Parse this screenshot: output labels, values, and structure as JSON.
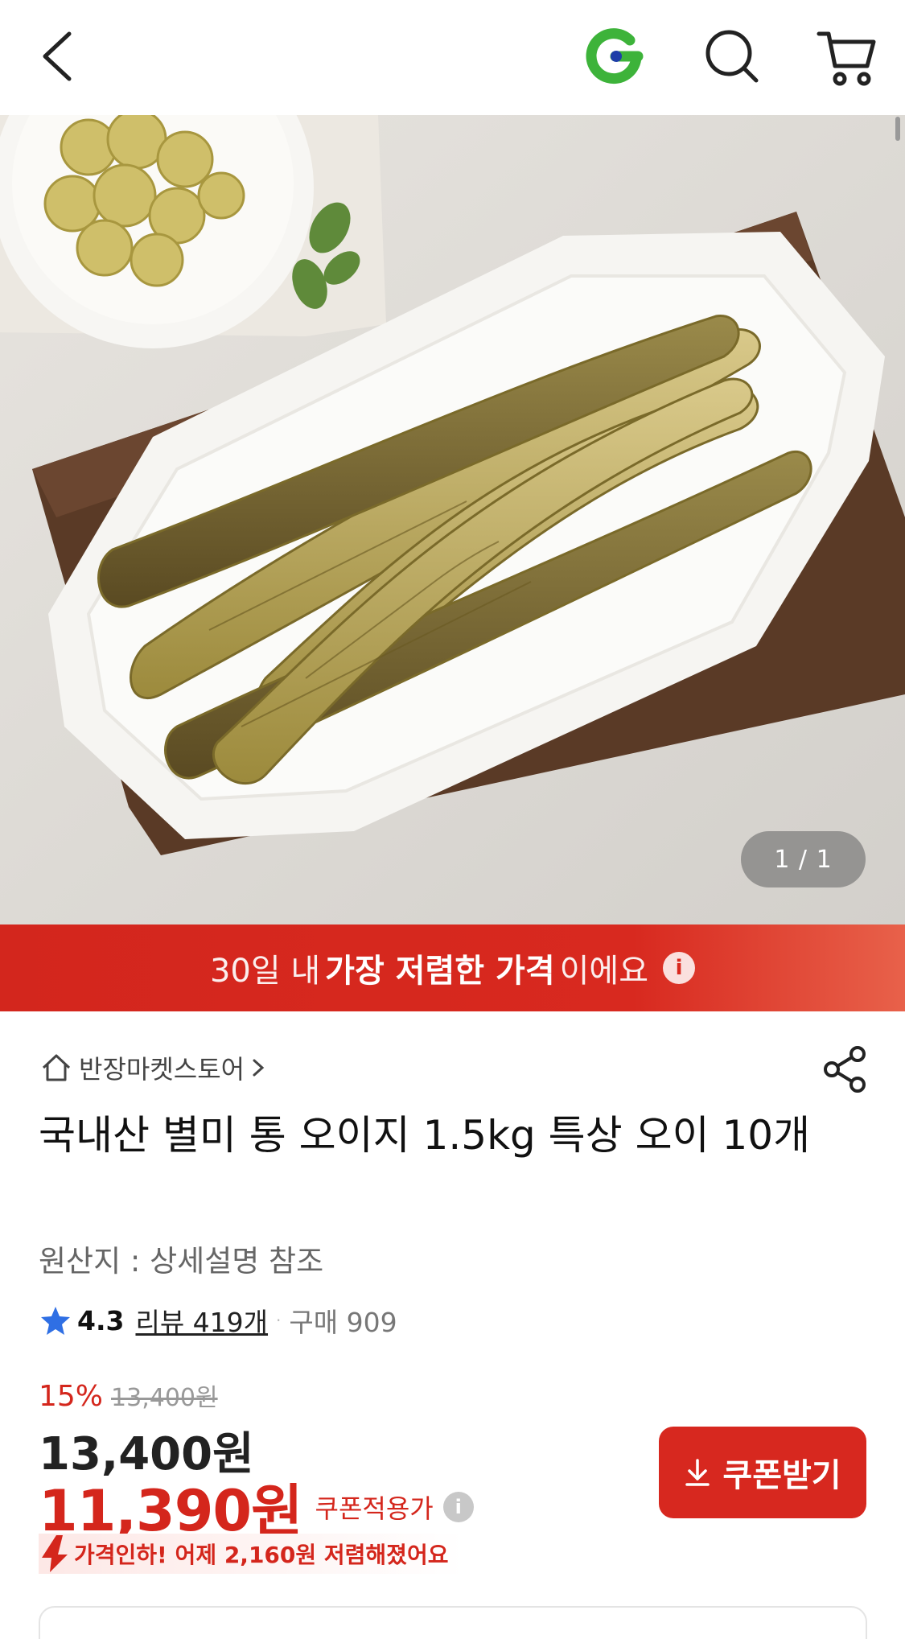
{
  "header": {
    "back_icon": "chevron-left-icon",
    "logo_icon": "g-logo-icon",
    "search_icon": "search-icon",
    "cart_icon": "cart-icon"
  },
  "gallery": {
    "indicator": "1 / 1"
  },
  "banner": {
    "part1": "30일 내",
    "part2": "가장 저렴한 가격",
    "part3": "이에요",
    "info_glyph": "i"
  },
  "product": {
    "store_name": "반장마켓스토어",
    "title": "국내산 별미 통 오이지 1.5kg 특상 오이 10개",
    "origin": "원산지 : 상세설명 참조",
    "rating": "4.3",
    "review_label": "리뷰 419개",
    "separator": "·",
    "purchase_label": "구매 909"
  },
  "pricing": {
    "discount_rate": "15%",
    "original_price": "13,400원",
    "current_price": "13,400원",
    "coupon_price": "11,390원",
    "coupon_label": "쿠폰적용가",
    "coupon_info_glyph": "i",
    "drop_text": "가격인하! 어제 2,160원 저렴해졌어요"
  },
  "actions": {
    "coupon_button": "쿠폰받기"
  },
  "colors": {
    "accent_red": "#d7281f",
    "logo_green": "#3db33a",
    "logo_blue": "#1e3fa8"
  }
}
